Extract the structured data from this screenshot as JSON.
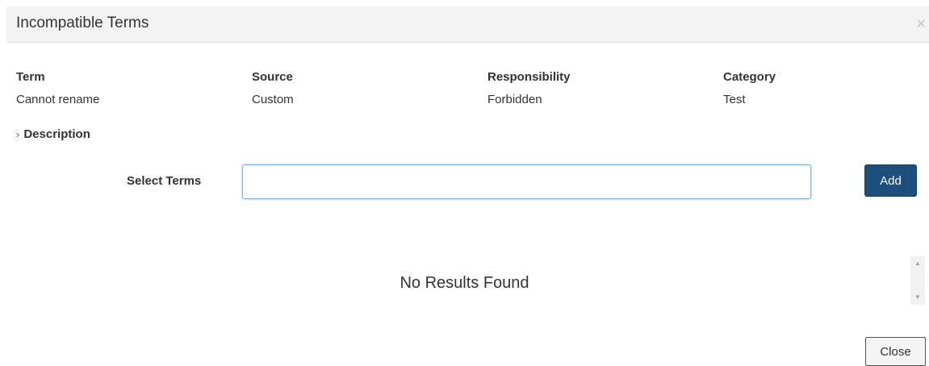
{
  "dialog": {
    "title": "Incompatible Terms",
    "close_icon": "×"
  },
  "info": {
    "term": {
      "label": "Term",
      "value": "Cannot rename"
    },
    "source": {
      "label": "Source",
      "value": "Custom"
    },
    "responsibility": {
      "label": "Responsibility",
      "value": "Forbidden"
    },
    "category": {
      "label": "Category",
      "value": "Test"
    }
  },
  "description": {
    "chevron": "›",
    "label": "Description"
  },
  "select_terms": {
    "label": "Select Terms",
    "value": "",
    "add_label": "Add"
  },
  "results": {
    "empty_text": "No Results Found",
    "scroll_up": "▲",
    "scroll_down": "▼"
  },
  "footer": {
    "close_label": "Close"
  },
  "colors": {
    "primary_button": "#1e4e7c",
    "header_bg": "#f3f3f3",
    "input_focus_border": "#77aee0"
  },
  "icons": {
    "close": "close-icon",
    "chevron": "chevron-right-icon",
    "scroll_up": "arrow-up-icon",
    "scroll_down": "arrow-down-icon"
  }
}
